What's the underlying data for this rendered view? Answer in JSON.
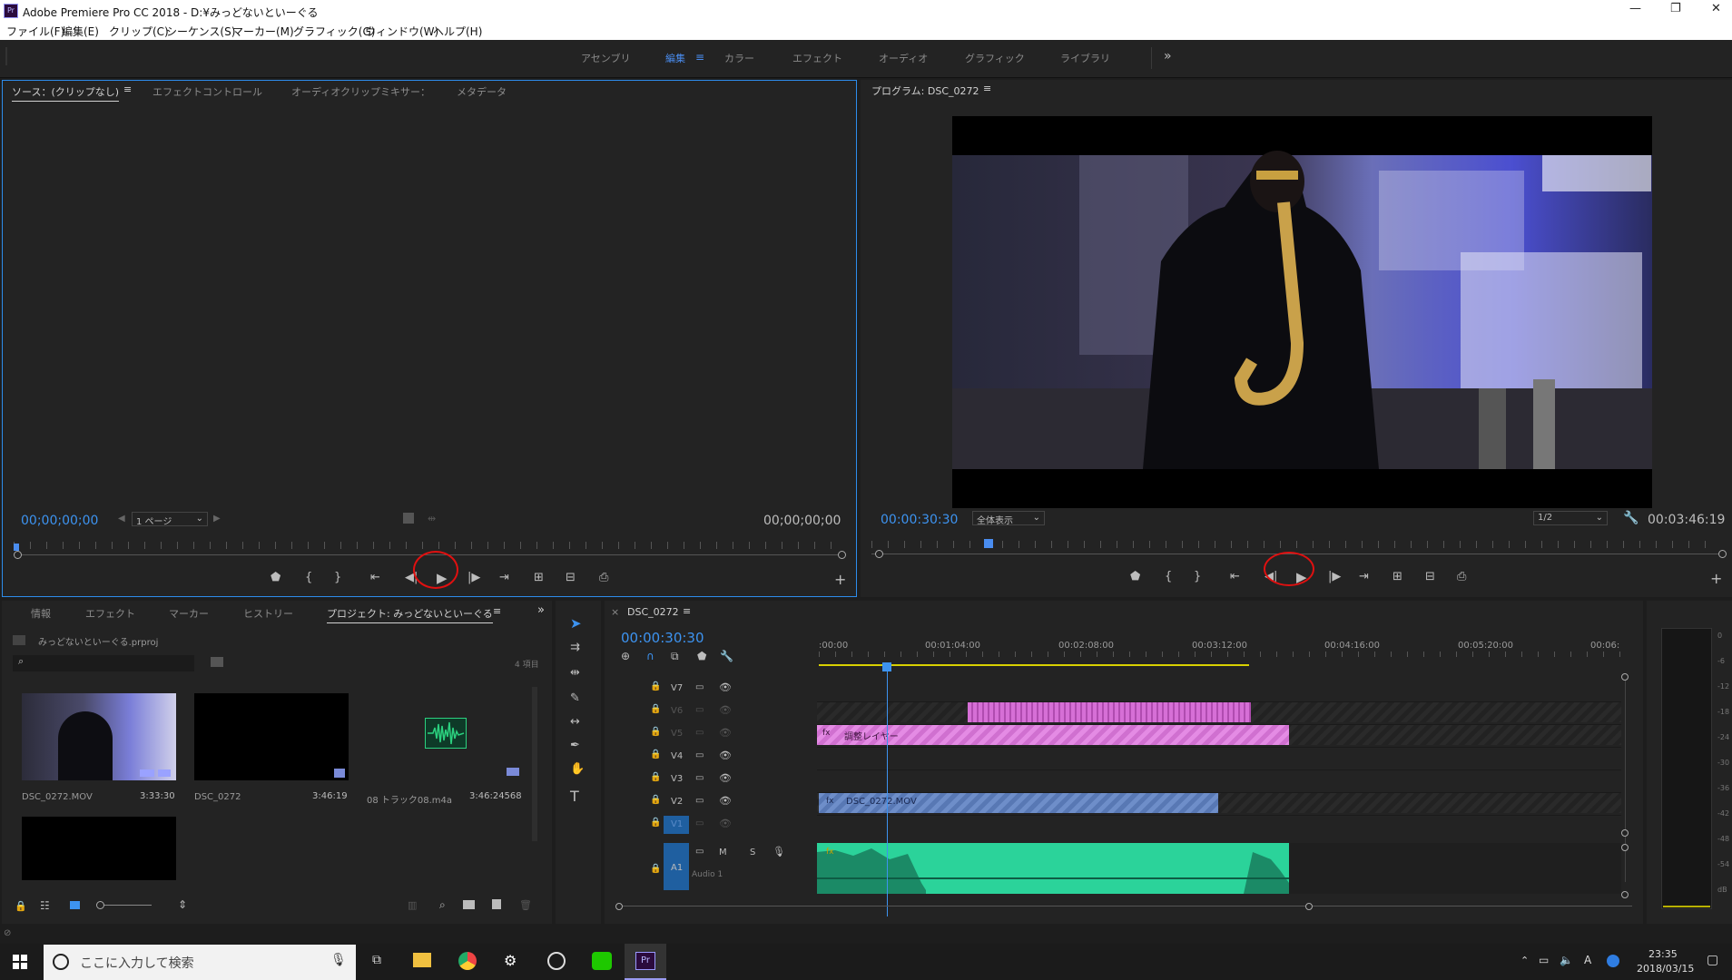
{
  "window": {
    "title": "Adobe Premiere Pro CC 2018 - D:¥みっどないといーぐる",
    "logo": "Pr"
  },
  "menu": [
    "ファイル(F)",
    "編集(E)",
    "クリップ(C)",
    "シーケンス(S)",
    "マーカー(M)",
    "グラフィック(G)",
    "ウィンドウ(W)",
    "ヘルプ(H)"
  ],
  "workspaces": [
    "アセンブリ",
    "編集",
    "カラー",
    "エフェクト",
    "オーディオ",
    "グラフィック",
    "ライブラリ"
  ],
  "source": {
    "tabs": [
      "ソース：(クリップなし)",
      "エフェクトコントロール",
      "オーディオクリップミキサー：",
      "メタデータ"
    ],
    "timecode_left": "00;00;00;00",
    "zoom": "1 ページ",
    "timecode_right": "00;00;00;00"
  },
  "program": {
    "tab": "プログラム: DSC_0272",
    "timecode_left": "00:00:30:30",
    "fit": "全体表示",
    "resolution": "1/2",
    "timecode_right": "00:03:46:19"
  },
  "project": {
    "tabs": [
      "情報",
      "エフェクト",
      "マーカー",
      "ヒストリー",
      "プロジェクト: みっどないといーぐる"
    ],
    "file": "みっどないといーぐる.prproj",
    "count": "4 項目",
    "items": [
      {
        "name": "DSC_0272.MOV",
        "duration": "3:33:30"
      },
      {
        "name": "DSC_0272",
        "duration": "3:46:19"
      },
      {
        "name": "08 トラック08.m4a",
        "duration": "3:46:24568"
      }
    ]
  },
  "timeline": {
    "seq": "DSC_0272",
    "timecode": "00:00:30:30",
    "ruler": [
      ":00:00",
      "00:01:04:00",
      "00:02:08:00",
      "00:03:12:00",
      "00:04:16:00",
      "00:05:20:00",
      "00:06:"
    ],
    "tracks": [
      "V7",
      "V6",
      "V5",
      "V4",
      "V3",
      "V2",
      "V1",
      "A1"
    ],
    "adjust_clip": "調整レイヤー",
    "video_clip": "DSC_0272.MOV",
    "audio_label": "Audio 1",
    "audio_m": "M",
    "audio_s": "S",
    "fx": "fx"
  },
  "meter": [
    "0",
    "-6",
    "-12",
    "-18",
    "-24",
    "-30",
    "-36",
    "-42",
    "-48",
    "-54",
    "dB"
  ],
  "taskbar": {
    "search": "ここに入力して検索",
    "time": "23:35",
    "date": "2018/03/15",
    "ime": "A",
    "pr": "Pr"
  }
}
